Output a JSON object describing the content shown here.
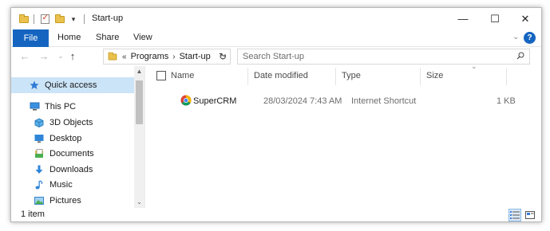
{
  "window": {
    "title": "Start-up",
    "controls": {
      "minimize": "—",
      "maximize": "☐",
      "close": "✕"
    }
  },
  "quick_access": {
    "dropdown": "▾"
  },
  "ribbon": {
    "file_tab": "File",
    "tabs": [
      "Home",
      "Share",
      "View"
    ],
    "expand_chevron": "⌄",
    "help": "?"
  },
  "address": {
    "overflow": "«",
    "crumbs": [
      "Programs",
      "Start-up"
    ],
    "separator": "›",
    "refresh": "↻"
  },
  "search": {
    "placeholder": "Search Start-up"
  },
  "nav": {
    "items": [
      {
        "label": "Quick access",
        "icon": "star-icon"
      },
      {
        "label": "This PC",
        "icon": "this-pc-icon"
      },
      {
        "label": "3D Objects",
        "icon": "cube-icon"
      },
      {
        "label": "Desktop",
        "icon": "desktop-icon"
      },
      {
        "label": "Documents",
        "icon": "documents-icon"
      },
      {
        "label": "Downloads",
        "icon": "download-arrow-icon"
      },
      {
        "label": "Music",
        "icon": "music-note-icon"
      },
      {
        "label": "Pictures",
        "icon": "pictures-icon"
      }
    ],
    "selected": "Quick access"
  },
  "columns": {
    "name": "Name",
    "date_modified": "Date modified",
    "type": "Type",
    "size": "Size"
  },
  "files": [
    {
      "name": "SuperCRM",
      "date_modified": "28/03/2024 7:43 AM",
      "type": "Internet Shortcut",
      "size": "1 KB",
      "icon": "chrome-icon"
    }
  ],
  "status": {
    "item_count": "1 item"
  },
  "colors": {
    "accent": "#1565c0",
    "selection": "#cce4f7",
    "folder": "#e9c14c"
  }
}
